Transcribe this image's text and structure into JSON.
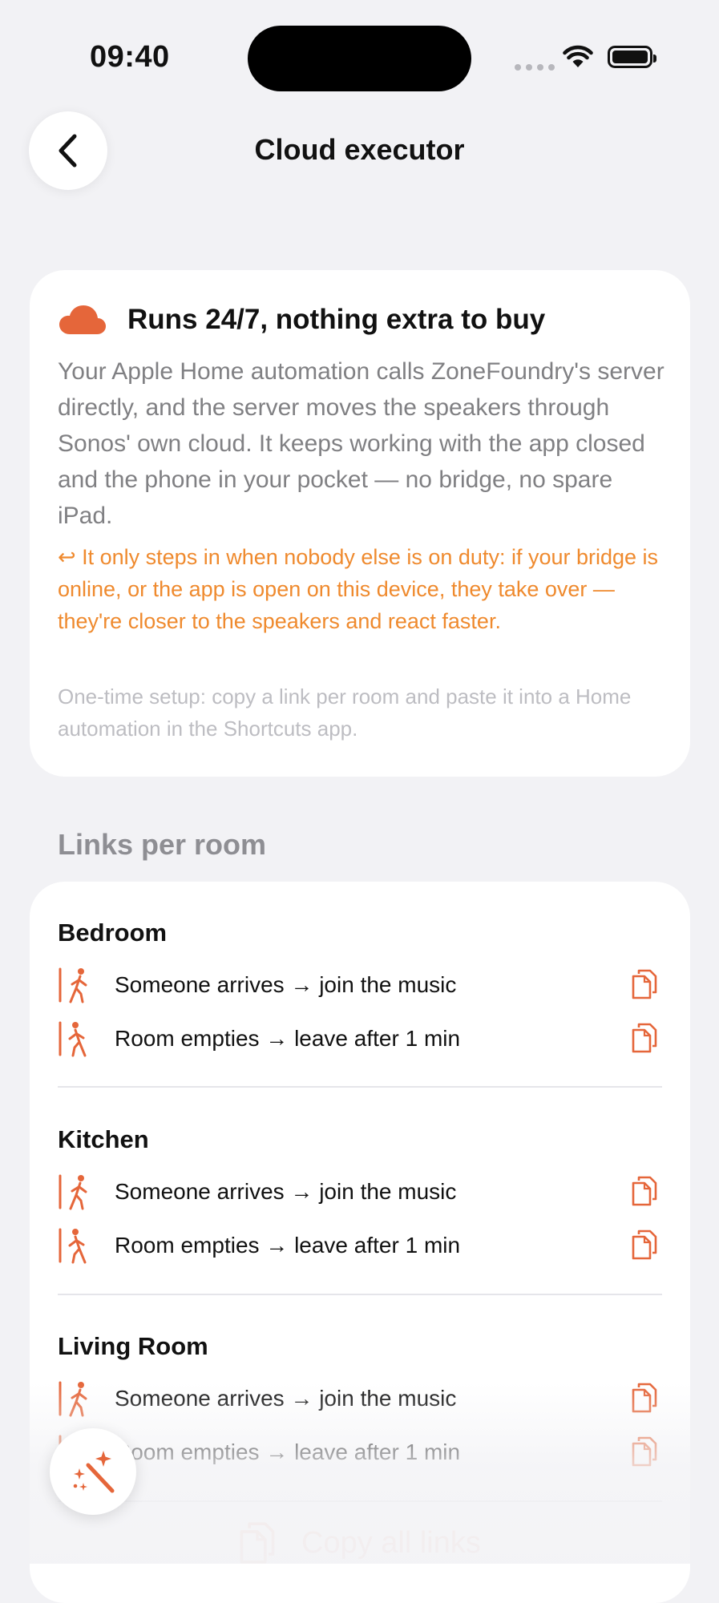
{
  "status": {
    "time": "09:40"
  },
  "nav": {
    "title": "Cloud executor"
  },
  "info": {
    "title": "Runs 24/7, nothing extra to buy",
    "body": "Your Apple Home automation calls ZoneFoundry's server directly, and the server moves the speakers through Sonos' own cloud. It keeps working with the app closed and the phone in your pocket — no bridge, no spare iPad.",
    "note": "↩ It only steps in when nobody else is on duty: if your bridge is online, or the app is open on this device, they take over — they're closer to the speakers and react faster.",
    "setup": "One-time setup: copy a link per room and paste it into a Home automation in the Shortcuts app."
  },
  "links_section": {
    "label": "Links per room"
  },
  "rooms": [
    {
      "name": "Bedroom",
      "links": [
        {
          "label": "Someone arrives → join the music"
        },
        {
          "label": "Room empties → leave after 1 min"
        }
      ]
    },
    {
      "name": "Kitchen",
      "links": [
        {
          "label": "Someone arrives → join the music"
        },
        {
          "label": "Room empties → leave after 1 min"
        }
      ]
    },
    {
      "name": "Living Room",
      "links": [
        {
          "label": "Someone arrives → join the music"
        },
        {
          "label": "Room empties → leave after 1 min"
        }
      ]
    }
  ],
  "copy_all": {
    "label": "Copy all links"
  },
  "colors": {
    "accent": "#e5663a",
    "note": "#ef8a2e",
    "secondary_text": "#808083",
    "section_label": "#8e8e93"
  },
  "icons": {
    "back": "chevron-left-icon",
    "cloud": "cloud-icon",
    "arrive": "person-walking-in-icon",
    "leave": "person-walking-out-icon",
    "copy": "copy-documents-icon",
    "magic": "magic-wand-icon"
  }
}
